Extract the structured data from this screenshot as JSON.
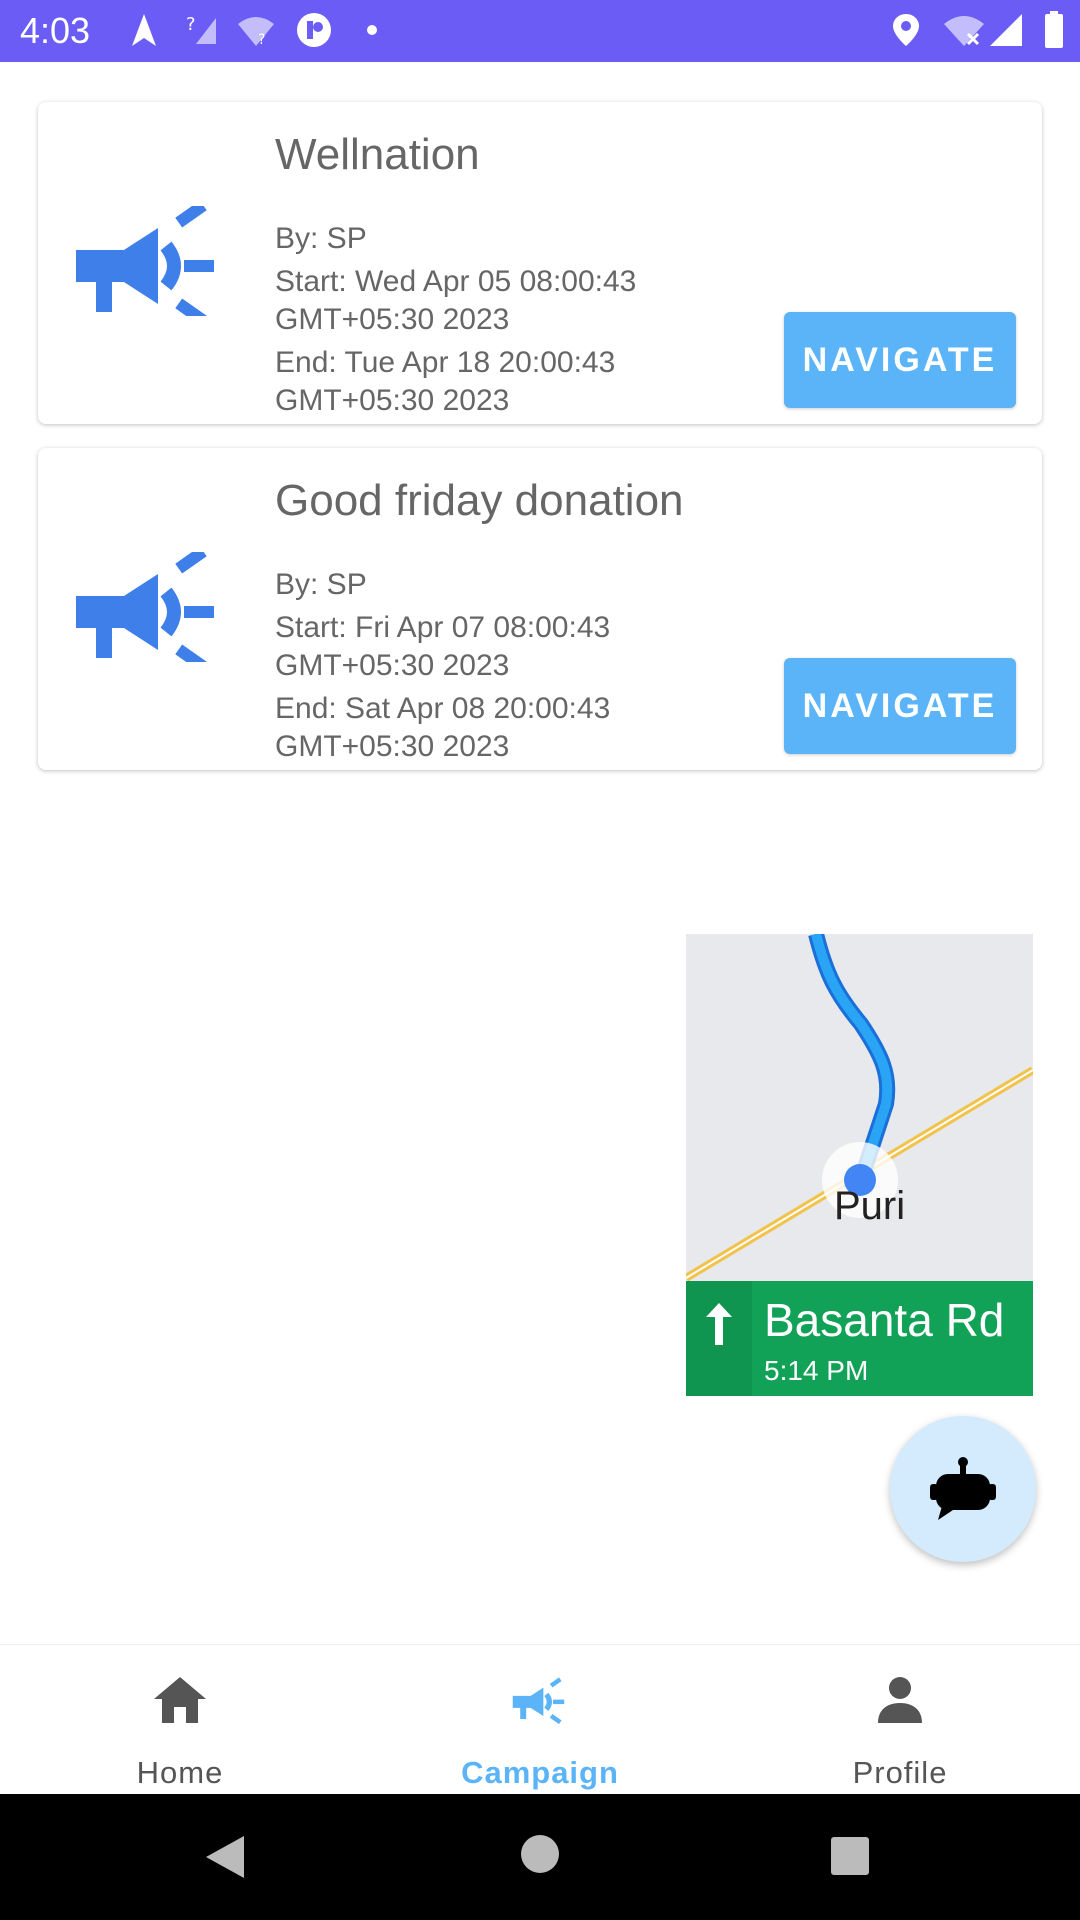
{
  "status_bar": {
    "time": "4:03"
  },
  "campaigns": [
    {
      "title": "Wellnation",
      "by": "By: SP",
      "start_line1": "Start: Wed Apr 05 08:00:43",
      "start_line2": "GMT+05:30 2023",
      "end_line1": "End: Tue Apr 18 20:00:43",
      "end_line2": "GMT+05:30 2023",
      "button": "NAVIGATE"
    },
    {
      "title": "Good friday donation",
      "by": "By: SP",
      "start_line1": "Start: Fri Apr 07 08:00:43",
      "start_line2": "GMT+05:30 2023",
      "end_line1": "End: Sat Apr 08 20:00:43",
      "end_line2": "GMT+05:30 2023",
      "button": "NAVIGATE"
    }
  ],
  "map": {
    "place": "Puri",
    "street": "Basanta Rd",
    "eta": "5:14 PM"
  },
  "bottom_nav": {
    "items": [
      {
        "label": "Home",
        "icon": "home-icon"
      },
      {
        "label": "Campaign",
        "icon": "megaphone-icon",
        "active": true
      },
      {
        "label": "Profile",
        "icon": "person-icon"
      }
    ]
  },
  "colors": {
    "status_bar": "#6a5cf5",
    "accent": "#5ab4f7",
    "icon_blue": "#3f7fea",
    "banner_green": "#11a157",
    "fab": "#d3ebfc"
  }
}
